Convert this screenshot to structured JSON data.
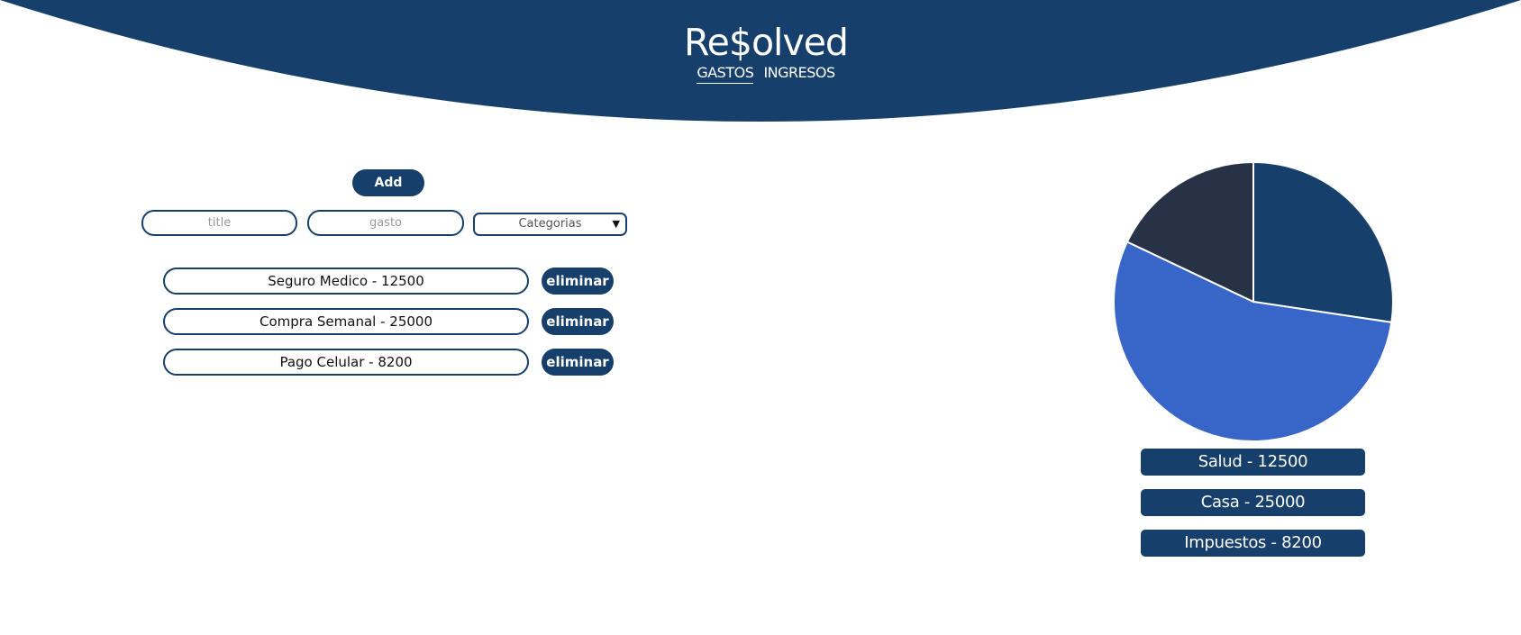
{
  "header": {
    "brand": "Re$olved",
    "tabs": [
      {
        "label": "GASTOS",
        "active": true
      },
      {
        "label": "INGRESOS",
        "active": false
      }
    ]
  },
  "form": {
    "add_label": "Add",
    "title_placeholder": "title",
    "gasto_placeholder": "gasto",
    "category_selected": "Categorias"
  },
  "expenses": [
    {
      "text": "Seguro Medico - 12500",
      "delete_label": "eliminar"
    },
    {
      "text": "Compra Semanal - 25000",
      "delete_label": "eliminar"
    },
    {
      "text": "Pago Celular - 8200",
      "delete_label": "eliminar"
    }
  ],
  "chart_data": {
    "type": "pie",
    "categories": [
      "Salud",
      "Casa",
      "Impuestos"
    ],
    "values": [
      12500,
      25000,
      8200
    ],
    "colors": [
      "#163f6b",
      "#3866c8",
      "#283247"
    ]
  },
  "legend": [
    {
      "label": "Salud - 12500"
    },
    {
      "label": "Casa - 25000"
    },
    {
      "label": "Impuestos - 8200"
    }
  ],
  "colors": {
    "primary": "#163f6b",
    "accent": "#3866c8",
    "dark": "#283247"
  }
}
